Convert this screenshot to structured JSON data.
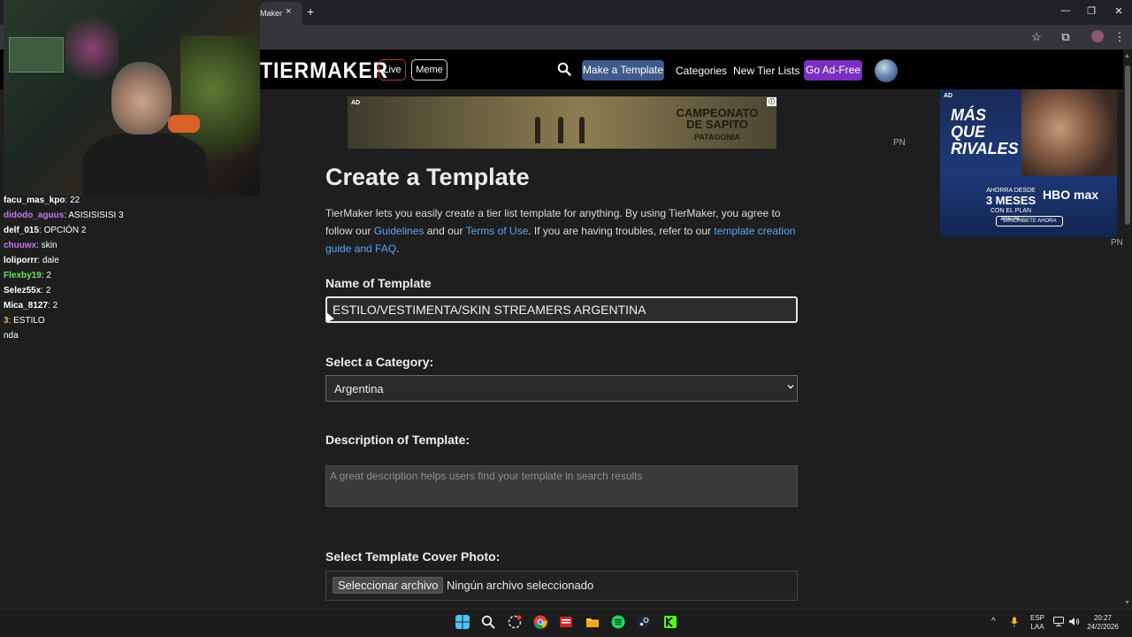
{
  "browser": {
    "tab_title": "Maker",
    "tab_close": "×",
    "new_tab": "+",
    "minimize": "—",
    "restore": "❐",
    "close": "✕",
    "star": "☆",
    "extensions": "⧉",
    "menu": "⋮"
  },
  "site": {
    "logo": "TIERMAKER",
    "pill_live": "Live",
    "pill_meme": "Meme",
    "make_template": "Make a Template",
    "categories": "Categories",
    "new_tier_lists": "New Tier Lists",
    "go_ad_free": "Go Ad-Free"
  },
  "ads": {
    "top_label": "AD",
    "top_title": "CAMPEONATO DE SAPITO",
    "top_subtitle": "PATAGONIA",
    "top_pn": "PN",
    "side_label": "AD",
    "side_title": "MÁS QUE RIVALES",
    "side_promo_line1": "AHORRA DESDE",
    "side_promo_big": "3 MESES",
    "side_promo_line2": "CON EL PLAN ANUAL",
    "side_brand": "HBO max",
    "side_cta": "SUSCRÍBETE AHORA",
    "side_pn": "PN"
  },
  "form": {
    "title": "Create a Template",
    "intro_1": "TierMaker lets you easily create a tier list template for anything. By using TierMaker, you agree to follow our ",
    "link_guidelines": "Guidelines",
    "intro_2": " and our ",
    "link_terms": "Terms of Use",
    "intro_3": ". If you are having troubles, refer to our ",
    "link_guide": "template creation guide and FAQ",
    "intro_4": ".",
    "name_label": "Name of Template",
    "name_value": "ESTILO/VESTIMENTA/SKIN STREAMERS ARGENTINA",
    "category_label": "Select a Category:",
    "category_value": "Argentina",
    "description_label": "Description of Template:",
    "description_placeholder": "A great description helps users find your template in search results",
    "cover_label": "Select Template Cover Photo:",
    "file_button": "Seleccionar archivo",
    "file_status": "Ningún archivo seleccionado"
  },
  "chat": [
    {
      "user": "facu_mas_kpo",
      "sep": ": ",
      "msg": "22",
      "color": "#ffffff"
    },
    {
      "user": "didodo_aguus",
      "sep": ": ",
      "msg": "ASISISISISI 3",
      "color": "#c07be8"
    },
    {
      "user": "delf_015",
      "sep": ": ",
      "msg": "OPCIÓN 2",
      "color": "#ffffff"
    },
    {
      "user": "chuuwx",
      "sep": ": ",
      "msg": "skin",
      "color": "#c07be8"
    },
    {
      "user": "loliporrr",
      "sep": ": ",
      "msg": "dale",
      "color": "#ffffff"
    },
    {
      "user": "Flexby19",
      "sep": ": ",
      "msg": "2",
      "color": "#6ee06a"
    },
    {
      "user": "Selez55x",
      "sep": ": ",
      "msg": "2",
      "color": "#ffffff"
    },
    {
      "user": "Mica_8127",
      "sep": ": ",
      "msg": "2",
      "color": "#ffffff"
    },
    {
      "user": "3",
      "sep": ": ",
      "msg": "ESTILO",
      "color": "#e6b84a"
    },
    {
      "user": "",
      "sep": "",
      "msg": "nda",
      "color": "#ffffff"
    }
  ],
  "taskbar": {
    "lang_1": "ESP",
    "lang_2": "LAA",
    "time": "20:27",
    "date": "24/2/2026",
    "tray_up": "^"
  },
  "colors": {
    "accent_blue": "#3f5a8a",
    "accent_purple": "#7a2fbf",
    "link": "#5ea3ee",
    "live_border": "#c0392b"
  }
}
